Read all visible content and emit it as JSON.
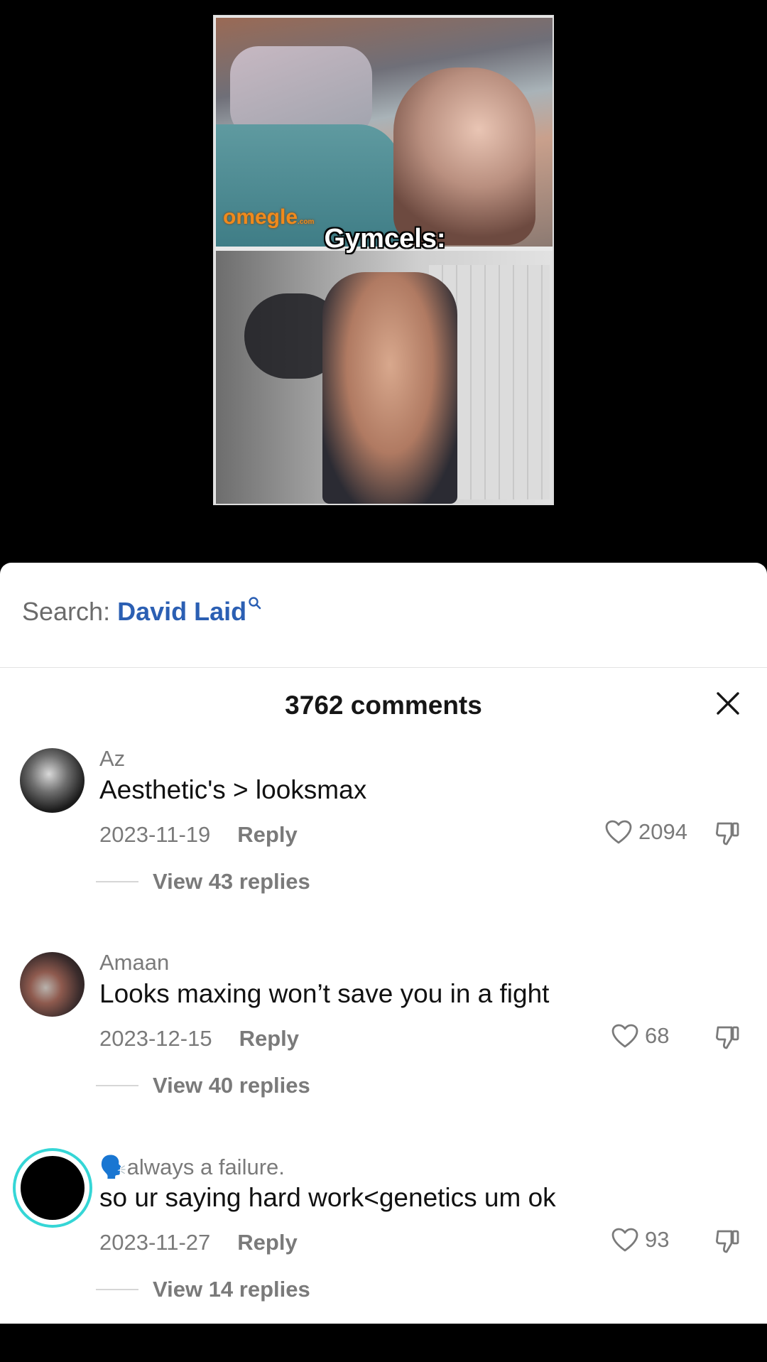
{
  "video": {
    "watermark": "omegle",
    "watermark_suffix": ".com",
    "caption": "Gymcels:"
  },
  "search": {
    "prefix": "Search:",
    "term": "David Laid"
  },
  "comments_header": {
    "count_label": "3762 comments"
  },
  "comments": [
    {
      "username": "Az",
      "text": "Aesthetic's > looksmax",
      "date": "2023-11-19",
      "reply_label": "Reply",
      "likes": "2094",
      "view_replies": "View 43 replies"
    },
    {
      "username": "Amaan",
      "text": "Looks maxing won’t save you in a fight",
      "date": "2023-12-15",
      "reply_label": "Reply",
      "likes": "68",
      "view_replies": "View 40 replies"
    },
    {
      "username_emoji": "🗣️",
      "username": "always a failure.",
      "text": "so ur saying hard work<genetics um ok",
      "date": "2023-11-27",
      "reply_label": "Reply",
      "likes": "93",
      "view_replies": "View 14 replies"
    }
  ],
  "colors": {
    "link_blue": "#2b5fb3",
    "meta_gray": "#7a7a7a",
    "story_ring": "#35d6d6"
  },
  "icons": [
    "search-icon",
    "close-icon",
    "heart-icon",
    "dislike-icon"
  ]
}
